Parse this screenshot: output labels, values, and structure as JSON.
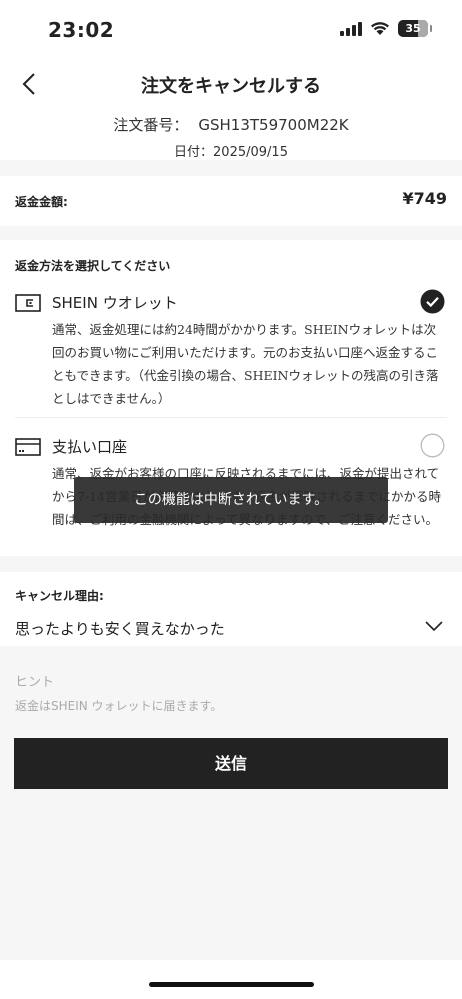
{
  "status_bar": {
    "time": "23:02",
    "battery": "35"
  },
  "header": {
    "title": "注文をキャンセルする",
    "order_number_label": "注文番号：",
    "order_number": "GSH13T59700M22K",
    "order_date": "日付：2025/09/15"
  },
  "refund": {
    "label": "返金金額:",
    "amount": "¥749"
  },
  "refund_method": {
    "title": "返金方法を選択してください",
    "options": [
      {
        "icon": "wallet-icon",
        "title": "SHEIN ウオレット",
        "selected": true,
        "description": "通常、返金処理には約24時間がかかります。SHEINウォレットは次回のお買い物にご利用いただけます。元のお支払い口座へ返金することもできます。（代金引換の場合、SHEINウォレットの残高の引き落としはできません。）"
      },
      {
        "icon": "credit-card-icon",
        "title": "支払い口座",
        "selected": false,
        "description": "通常、返金がお客様の口座に反映されるまでには、返金が提出されてから7-14営業日が必要となります。返金が反映されるまでにかかる時間は、ご利用の金融機関によって異なりますので、ご注意ください。"
      }
    ]
  },
  "toast": {
    "text": "この機能は中断されています。"
  },
  "cancel_reason": {
    "label": "キャンセル理由:",
    "selected": "思ったよりも安く買えなかった"
  },
  "hint": {
    "title": "ヒント",
    "text": "返金はSHEIN ウォレットに届きます。"
  },
  "submit": {
    "label": "送信"
  },
  "colors": {
    "primary": "#222222",
    "background": "#f6f6f6",
    "hint": "#aaaaaa",
    "toast": "#282828"
  }
}
